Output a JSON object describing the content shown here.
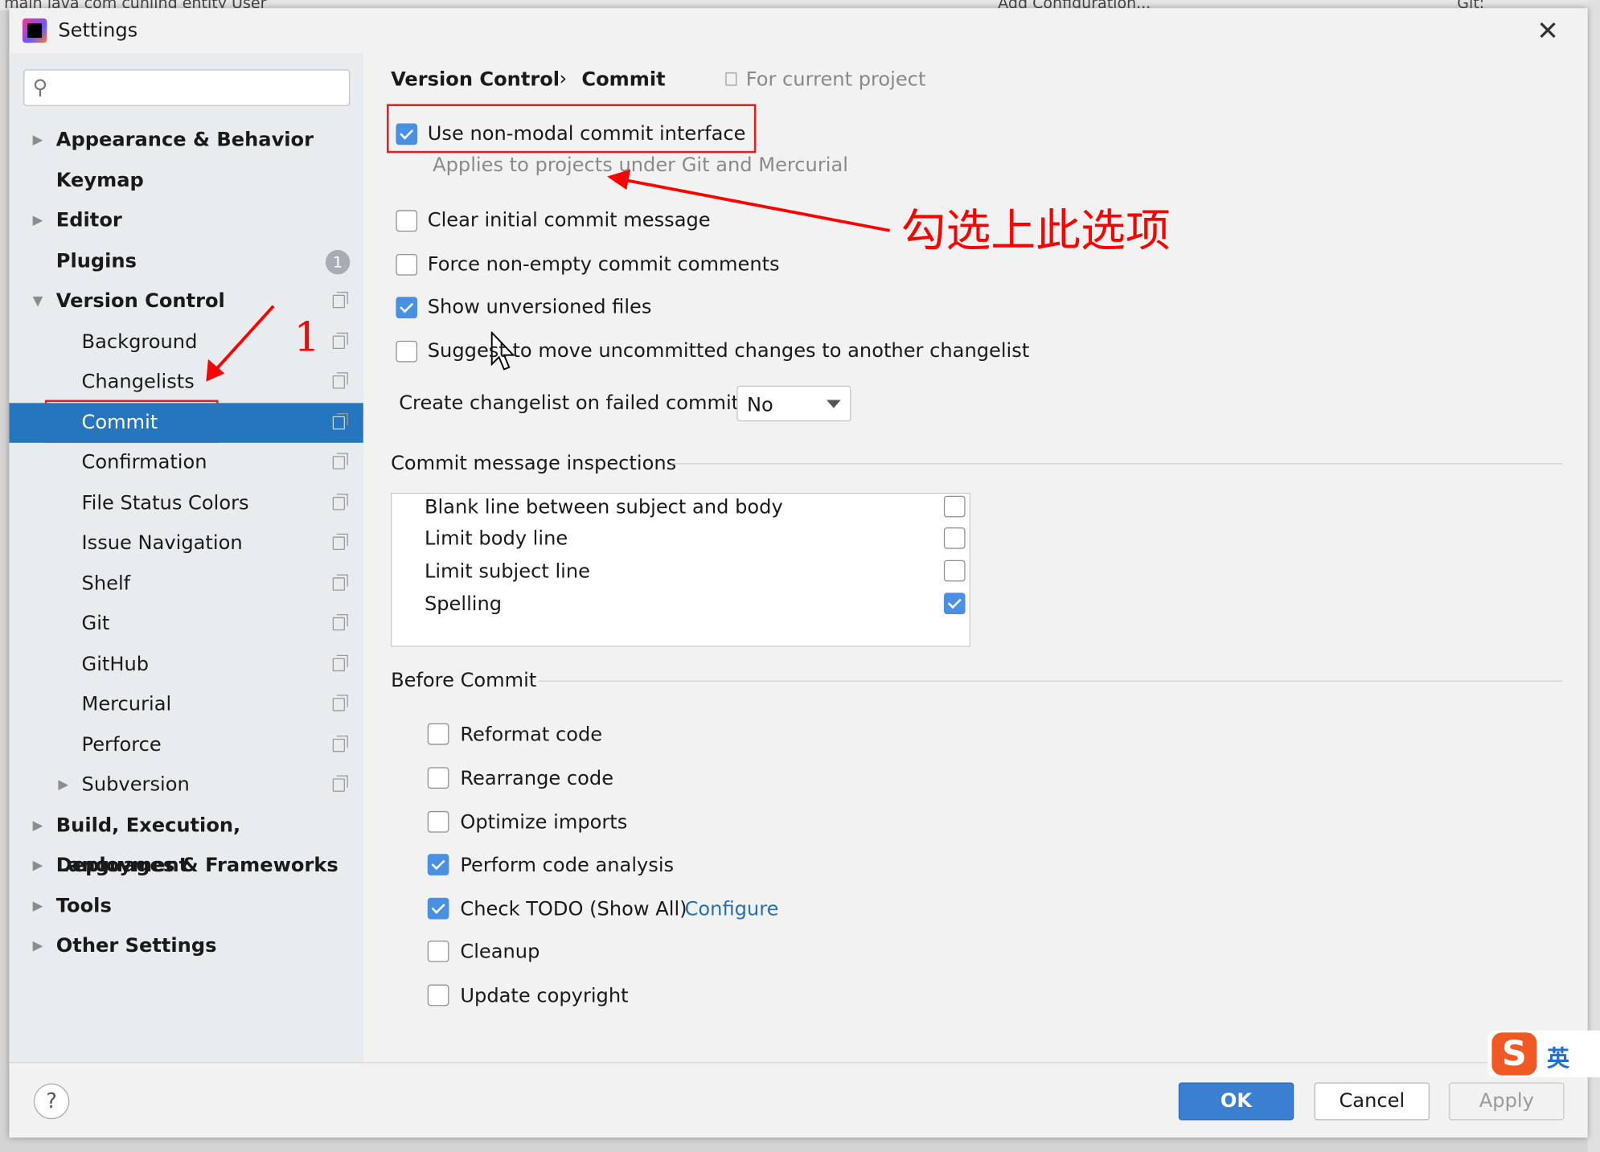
{
  "background_ide": {
    "breadcrumb": "main  java  com  cunling  entity  User",
    "run_config": "Add Configuration...",
    "git": "Git:"
  },
  "dialog": {
    "title": "Settings",
    "close_icon": "close-icon"
  },
  "search": {
    "placeholder": "",
    "icon": "search-icon"
  },
  "tree": [
    {
      "label": "Appearance & Behavior",
      "level": 0,
      "bold": true,
      "expandable": true
    },
    {
      "label": "Keymap",
      "level": 0,
      "bold": true
    },
    {
      "label": "Editor",
      "level": 0,
      "bold": true,
      "expandable": true
    },
    {
      "label": "Plugins",
      "level": 0,
      "bold": true,
      "badge": "1"
    },
    {
      "label": "Version Control",
      "level": 0,
      "bold": true,
      "expanded": true,
      "copy": true
    },
    {
      "label": "Background",
      "level": 1,
      "copy": true
    },
    {
      "label": "Changelists",
      "level": 1,
      "copy": true
    },
    {
      "label": "Commit",
      "level": 1,
      "copy": true,
      "selected": true
    },
    {
      "label": "Confirmation",
      "level": 1,
      "copy": true
    },
    {
      "label": "File Status Colors",
      "level": 1,
      "copy": true
    },
    {
      "label": "Issue Navigation",
      "level": 1,
      "copy": true
    },
    {
      "label": "Shelf",
      "level": 1,
      "copy": true
    },
    {
      "label": "Git",
      "level": 1,
      "copy": true
    },
    {
      "label": "GitHub",
      "level": 1,
      "copy": true
    },
    {
      "label": "Mercurial",
      "level": 1,
      "copy": true
    },
    {
      "label": "Perforce",
      "level": 1,
      "copy": true
    },
    {
      "label": "Subversion",
      "level": 1,
      "copy": true,
      "expandable": true
    },
    {
      "label": "Build, Execution, Deployment",
      "level": 0,
      "bold": true,
      "expandable": true
    },
    {
      "label": "Languages & Frameworks",
      "level": 0,
      "bold": true,
      "expandable": true
    },
    {
      "label": "Tools",
      "level": 0,
      "bold": true,
      "expandable": true
    },
    {
      "label": "Other Settings",
      "level": 0,
      "bold": true,
      "expandable": true
    }
  ],
  "breadcrumb": {
    "parent": "Version Control",
    "sep": "›",
    "current": "Commit",
    "scope": "For current project"
  },
  "options": [
    {
      "label": "Use non-modal commit interface",
      "checked": true
    },
    {
      "label": "Clear initial commit message",
      "checked": false
    },
    {
      "label": "Force non-empty commit comments",
      "checked": false
    },
    {
      "label": "Show unversioned files",
      "checked": true
    },
    {
      "label": "Suggest to move uncommitted changes to another changelist",
      "checked": false
    }
  ],
  "non_modal_hint": "Applies to projects under Git and Mercurial",
  "changelist": {
    "label": "Create changelist on failed commit:",
    "value": "No"
  },
  "inspections": {
    "title": "Commit message inspections",
    "items": [
      {
        "label": "Blank line between subject and body",
        "checked": false
      },
      {
        "label": "Limit body line",
        "checked": false
      },
      {
        "label": "Limit subject line",
        "checked": false
      },
      {
        "label": "Spelling",
        "checked": true
      }
    ]
  },
  "before_commit": {
    "title": "Before Commit",
    "items": [
      {
        "label": "Reformat code",
        "checked": false
      },
      {
        "label": "Rearrange code",
        "checked": false
      },
      {
        "label": "Optimize imports",
        "checked": false
      },
      {
        "label": "Perform code analysis",
        "checked": true
      },
      {
        "label": "Check TODO (Show All)",
        "checked": true,
        "link": "Configure"
      },
      {
        "label": "Cleanup",
        "checked": false
      },
      {
        "label": "Update copyright",
        "checked": false
      }
    ]
  },
  "footer": {
    "help": "?",
    "ok": "OK",
    "cancel": "Cancel",
    "apply": "Apply"
  },
  "annotations": {
    "step": "1",
    "note": "勾选上此选项",
    "color": "#ff0000"
  },
  "ime": {
    "logo": "S",
    "mode": "英"
  },
  "colors": {
    "accent": "#2675bf",
    "ok_button": "#3a7fd0",
    "link": "#2470b3"
  }
}
